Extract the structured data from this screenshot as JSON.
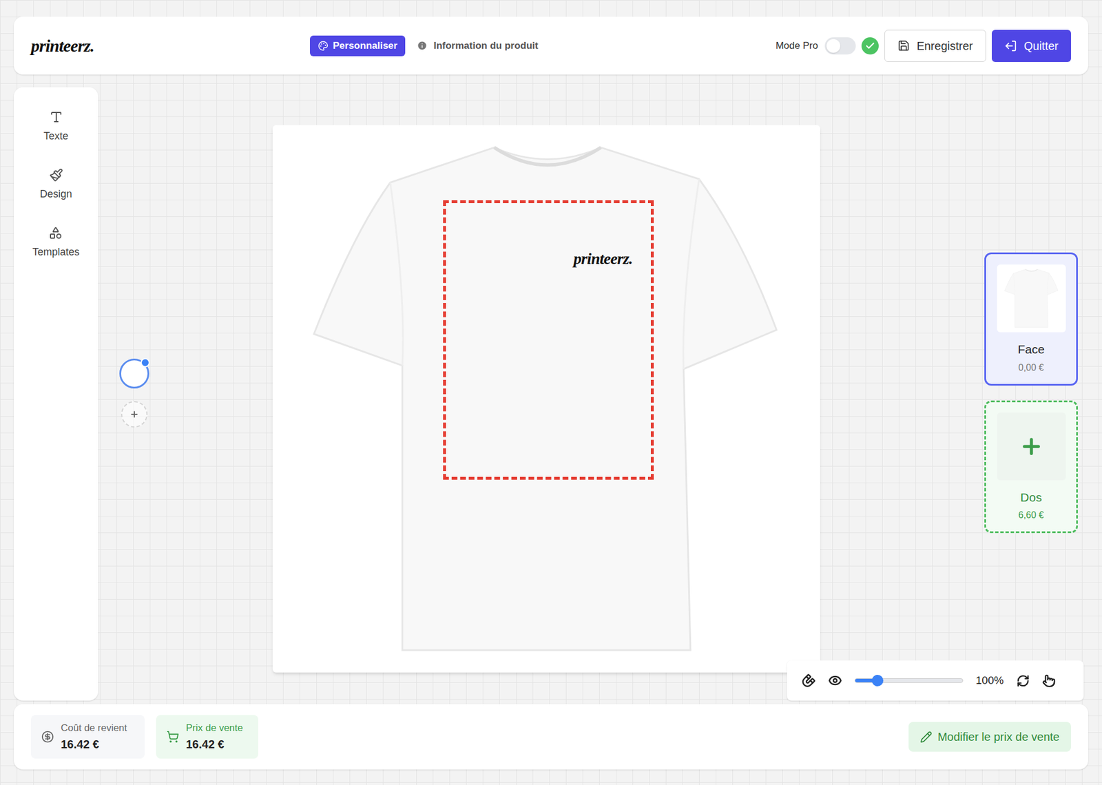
{
  "header": {
    "logo": "printeerz.",
    "tabs": [
      {
        "label": "Personnaliser",
        "selected": true
      },
      {
        "label": "Information du produit",
        "selected": false
      }
    ],
    "mode_pro": {
      "label": "Mode Pro",
      "on": false
    },
    "saved": true,
    "buttons": [
      {
        "label": "Enregistrer",
        "kind": "outline"
      },
      {
        "label": "Quitter",
        "kind": "primary"
      }
    ]
  },
  "sidebar": {
    "items": [
      {
        "label": "Texte",
        "kind": "text"
      },
      {
        "label": "Design",
        "kind": "design"
      },
      {
        "label": "Templates",
        "kind": "templates"
      }
    ]
  },
  "canvas": {
    "print_logo": "printeerz.",
    "layers": [
      {
        "selected": true
      }
    ],
    "zoom": {
      "level": 0.21,
      "reading": "100%"
    }
  },
  "views": [
    {
      "label": "Face",
      "price": "0,00 €",
      "selected": true,
      "kind": "preview"
    },
    {
      "label": "Dos",
      "price": "6,60 €",
      "selected": false,
      "kind": "add"
    }
  ],
  "footer": {
    "cost": {
      "label": "Coût de revient",
      "value": "16.42 €"
    },
    "sale": {
      "label": "Prix de vente",
      "value": "16.42 €"
    },
    "button": "Modifier le prix de vente"
  }
}
